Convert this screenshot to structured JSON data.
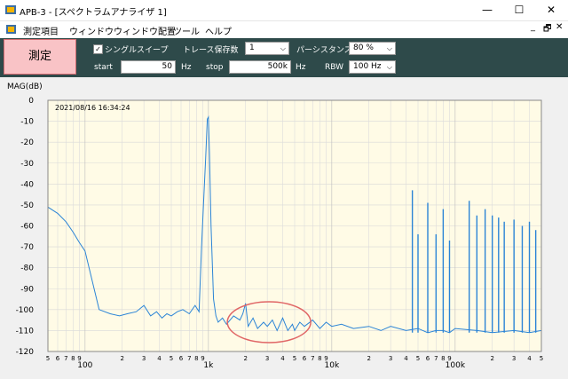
{
  "window": {
    "title": "APB-3 - [スペクトラムアナライザ 1]",
    "minimize": "—",
    "maximize": "☐",
    "close": "✕"
  },
  "menu": {
    "items": [
      "測定項目",
      "ウィンドウ",
      "ウィンドウ配置",
      "ツール",
      "ヘルプ"
    ],
    "mdi_min": "_",
    "mdi_restore": "🗗",
    "mdi_close": "✕"
  },
  "toolbar": {
    "measure_label": "測定",
    "single_sweep_label": "シングルスイープ",
    "single_sweep_checked": true,
    "trace_label": "トレース保存数",
    "trace_value": "1",
    "persistence_label": "パーシスタンス",
    "persistence_value": "80 %",
    "start_label": "start",
    "start_value": "50",
    "start_unit": "Hz",
    "stop_label": "stop",
    "stop_value": "500k",
    "stop_unit": "Hz",
    "rbw_label": "RBW",
    "rbw_value": "100 Hz"
  },
  "chart_data": {
    "type": "line",
    "ylabel": "MAG(dB)",
    "timestamp": "2021/08/16 16:34:24",
    "xscale": "log",
    "xlim": [
      50,
      500000
    ],
    "ylim": [
      -120,
      0
    ],
    "yticks": [
      0,
      -10,
      -20,
      -30,
      -40,
      -50,
      -60,
      -70,
      -80,
      -90,
      -100,
      -110,
      -120
    ],
    "xtick_labels": [
      {
        "x": 50,
        "label": "5"
      },
      {
        "x": 60,
        "label": "6"
      },
      {
        "x": 70,
        "label": "7"
      },
      {
        "x": 80,
        "label": "8"
      },
      {
        "x": 90,
        "label": "9"
      },
      {
        "x": 100,
        "label": "100"
      },
      {
        "x": 200,
        "label": "2"
      },
      {
        "x": 300,
        "label": "3"
      },
      {
        "x": 400,
        "label": "4"
      },
      {
        "x": 500,
        "label": "5"
      },
      {
        "x": 600,
        "label": "6"
      },
      {
        "x": 700,
        "label": "7"
      },
      {
        "x": 800,
        "label": "8"
      },
      {
        "x": 900,
        "label": "9"
      },
      {
        "x": 1000,
        "label": "1k"
      },
      {
        "x": 2000,
        "label": "2"
      },
      {
        "x": 3000,
        "label": "3"
      },
      {
        "x": 4000,
        "label": "4"
      },
      {
        "x": 5000,
        "label": "5"
      },
      {
        "x": 6000,
        "label": "6"
      },
      {
        "x": 7000,
        "label": "7"
      },
      {
        "x": 8000,
        "label": "8"
      },
      {
        "x": 9000,
        "label": "9"
      },
      {
        "x": 10000,
        "label": "10k"
      },
      {
        "x": 20000,
        "label": "2"
      },
      {
        "x": 30000,
        "label": "3"
      },
      {
        "x": 40000,
        "label": "4"
      },
      {
        "x": 50000,
        "label": "5"
      },
      {
        "x": 60000,
        "label": "6"
      },
      {
        "x": 70000,
        "label": "7"
      },
      {
        "x": 80000,
        "label": "8"
      },
      {
        "x": 90000,
        "label": "9"
      },
      {
        "x": 100000,
        "label": "100k"
      },
      {
        "x": 200000,
        "label": "2"
      },
      {
        "x": 300000,
        "label": "3"
      },
      {
        "x": 400000,
        "label": "4"
      },
      {
        "x": 500000,
        "label": "5"
      }
    ],
    "grid": true,
    "background": "#fffbe6",
    "line_color": "#2b84d6",
    "annotation_color": "#e06666",
    "series": [
      {
        "values_x": [
          50,
          60,
          70,
          80,
          90,
          100,
          130,
          160,
          190,
          220,
          260,
          300,
          340,
          380,
          420,
          460,
          500,
          560,
          620,
          700,
          780,
          840,
          880,
          920,
          950,
          980,
          1000,
          1020,
          1050,
          1100,
          1150,
          1200,
          1300,
          1400,
          1600,
          1800,
          1900,
          2000,
          2100,
          2300,
          2500,
          2800,
          3000,
          3300,
          3600,
          4000,
          4400,
          4800,
          5000,
          5500,
          6000,
          7000,
          8000,
          9000,
          10000,
          12000,
          15000,
          20000,
          25000,
          30000,
          40000,
          50000,
          60000,
          70000,
          80000,
          90000,
          100000,
          150000,
          200000,
          300000,
          400000,
          500000
        ],
        "values_y": [
          -51,
          -54,
          -58,
          -63,
          -68,
          -72,
          -100,
          -102,
          -103,
          -102,
          -101,
          -98,
          -103,
          -101,
          -104,
          -102,
          -103,
          -101,
          -100,
          -102,
          -98,
          -101,
          -70,
          -45,
          -28,
          -9,
          -8,
          -25,
          -60,
          -95,
          -103,
          -106,
          -104,
          -107,
          -103,
          -105,
          -102,
          -97,
          -108,
          -104,
          -109,
          -106,
          -108,
          -105,
          -110,
          -104,
          -110,
          -107,
          -110,
          -106,
          -108,
          -105,
          -109,
          -106,
          -108,
          -107,
          -109,
          -108,
          -110,
          -108,
          -110,
          -109,
          -111,
          -110,
          -110,
          -111,
          -109,
          -110,
          -111,
          -110,
          -111,
          -110
        ]
      }
    ],
    "spikes": [
      {
        "x": 45000,
        "y": -43
      },
      {
        "x": 50000,
        "y": -64
      },
      {
        "x": 60000,
        "y": -49
      },
      {
        "x": 70000,
        "y": -64
      },
      {
        "x": 80000,
        "y": -52
      },
      {
        "x": 90000,
        "y": -67
      },
      {
        "x": 130000,
        "y": -48
      },
      {
        "x": 150000,
        "y": -55
      },
      {
        "x": 175000,
        "y": -52
      },
      {
        "x": 200000,
        "y": -55
      },
      {
        "x": 225000,
        "y": -56
      },
      {
        "x": 250000,
        "y": -58
      },
      {
        "x": 300000,
        "y": -57
      },
      {
        "x": 350000,
        "y": -60
      },
      {
        "x": 400000,
        "y": -58
      },
      {
        "x": 450000,
        "y": -62
      }
    ],
    "annotation": {
      "type": "ellipse",
      "cx": 3100,
      "cy": -106,
      "note": ""
    }
  }
}
